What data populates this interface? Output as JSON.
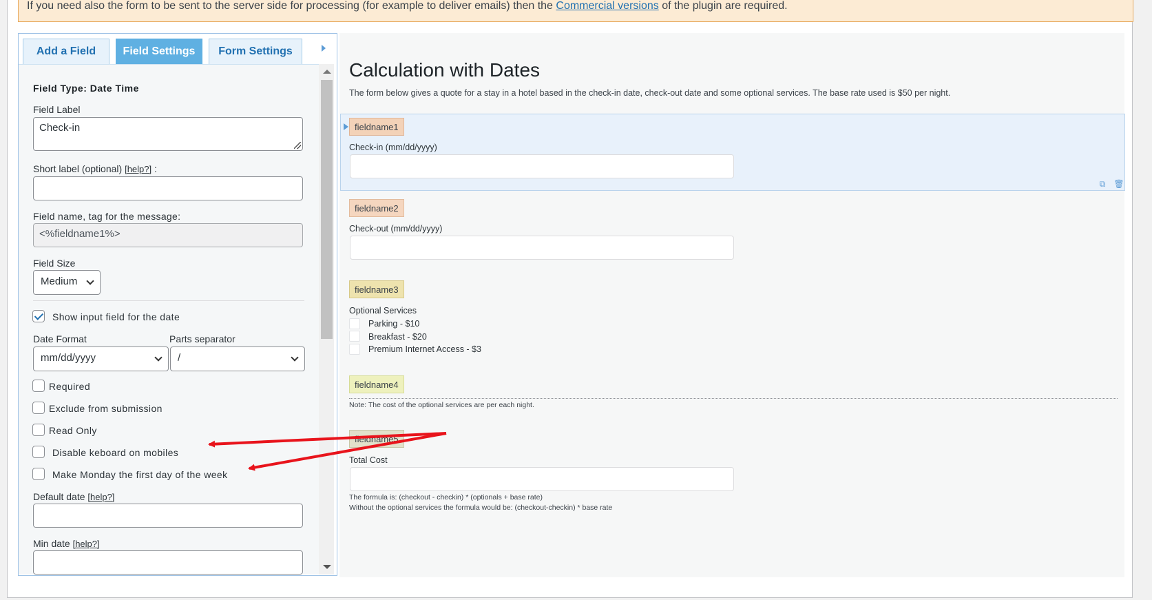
{
  "notice": {
    "text_before": "If you need also the form to be sent to the server side for processing (for example to deliver emails) then the ",
    "link": "Commercial versions",
    "text_after": " of the plugin are required."
  },
  "tabs": [
    {
      "label": "Add a Field"
    },
    {
      "label": "Field Settings"
    },
    {
      "label": "Form Settings"
    }
  ],
  "settings": {
    "field_type": "Field Type: Date Time",
    "field_label": "Field Label",
    "field_label_value": "Check-in",
    "short_label": "Short label (optional) ",
    "help": "[help?]",
    "short_label_suffix": " :",
    "field_name_label": "Field name, tag for the message:",
    "field_name_value": "<%fieldname1%>",
    "field_size_label": "Field Size",
    "field_size_value": "Medium",
    "show_input": "Show input field for the date",
    "date_format_label": "Date Format",
    "date_format_value": "mm/dd/yyyy",
    "parts_separator_label": "Parts separator",
    "parts_separator_value": "/",
    "required": "Required",
    "exclude": "Exclude from submission",
    "read_only": "Read Only",
    "disable_keyboard": "Disable keboard on mobiles",
    "monday_first": "Make Monday the first day of the week",
    "default_date": "Default date ",
    "min_date": "Min date "
  },
  "form": {
    "title": "Calculation with Dates",
    "description": "The form below gives a quote for a stay in a hotel based in the check-in date, check-out date and some optional services. The base rate used is $50 per night.",
    "fields": [
      {
        "tag": "fieldname1",
        "label": "Check-in (mm/dd/yyyy)"
      },
      {
        "tag": "fieldname2",
        "label": "Check-out (mm/dd/yyyy)"
      },
      {
        "tag": "fieldname3",
        "label": "Optional Services"
      },
      {
        "tag": "fieldname4",
        "label": "Note: The cost of the optional services are per each night."
      },
      {
        "tag": "fieldname5",
        "label": "Total Cost"
      }
    ],
    "services": [
      "Parking - $10",
      "Breakfast - $20",
      "Premium Internet Access - $3"
    ],
    "formula_note_1": "The formula is: (checkout - checkin) * (optionals + base rate)",
    "formula_note_2": "Without the optional services the formula would be: (checkout-checkin) * base rate"
  },
  "colors": {
    "annotation_arrow": "#e8141c",
    "active_tab": "#5fb0e2",
    "link": "#2271b1"
  }
}
